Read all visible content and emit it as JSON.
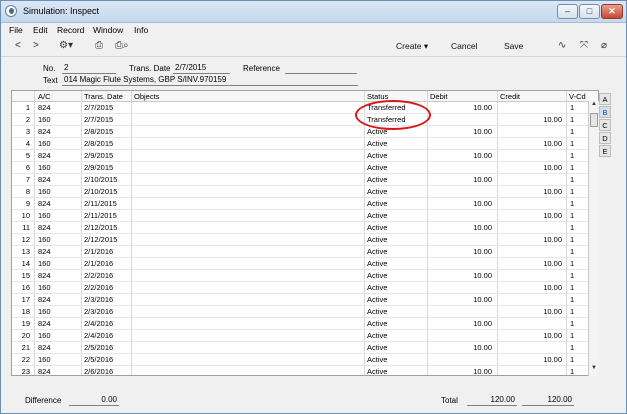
{
  "window": {
    "title": "Simulation: Inspect"
  },
  "menubar": {
    "items": [
      "File",
      "Edit",
      "Record",
      "Window",
      "Info"
    ]
  },
  "toolbar": {
    "create_label": "Create",
    "cancel_label": "Cancel",
    "save_label": "Save"
  },
  "header": {
    "no_label": "No.",
    "no_value": "2",
    "trans_date_label": "Trans. Date",
    "trans_date_value": "2/7/2015",
    "reference_label": "Reference",
    "reference_value": "",
    "text_label": "Text",
    "text_value": "014 Magic Flute Systems, GBP  S/INV.970159"
  },
  "grid": {
    "columns": [
      "A/C",
      "Trans. Date",
      "Objects",
      "Status",
      "Debit",
      "Credit",
      "V-Cd"
    ],
    "rows": [
      {
        "n": "1",
        "ac": "824",
        "date": "2/7/2015",
        "status": "Transferred",
        "debit": "10.00",
        "credit": "",
        "vcd": "1"
      },
      {
        "n": "2",
        "ac": "160",
        "date": "2/7/2015",
        "status": "Transferred",
        "debit": "",
        "credit": "10.00",
        "vcd": "1"
      },
      {
        "n": "3",
        "ac": "824",
        "date": "2/8/2015",
        "status": "Active",
        "debit": "10.00",
        "credit": "",
        "vcd": "1"
      },
      {
        "n": "4",
        "ac": "160",
        "date": "2/8/2015",
        "status": "Active",
        "debit": "",
        "credit": "10.00",
        "vcd": "1"
      },
      {
        "n": "5",
        "ac": "824",
        "date": "2/9/2015",
        "status": "Active",
        "debit": "10.00",
        "credit": "",
        "vcd": "1"
      },
      {
        "n": "6",
        "ac": "160",
        "date": "2/9/2015",
        "status": "Active",
        "debit": "",
        "credit": "10.00",
        "vcd": "1"
      },
      {
        "n": "7",
        "ac": "824",
        "date": "2/10/2015",
        "status": "Active",
        "debit": "10.00",
        "credit": "",
        "vcd": "1"
      },
      {
        "n": "8",
        "ac": "160",
        "date": "2/10/2015",
        "status": "Active",
        "debit": "",
        "credit": "10.00",
        "vcd": "1"
      },
      {
        "n": "9",
        "ac": "824",
        "date": "2/11/2015",
        "status": "Active",
        "debit": "10.00",
        "credit": "",
        "vcd": "1"
      },
      {
        "n": "10",
        "ac": "160",
        "date": "2/11/2015",
        "status": "Active",
        "debit": "",
        "credit": "10.00",
        "vcd": "1"
      },
      {
        "n": "11",
        "ac": "824",
        "date": "2/12/2015",
        "status": "Active",
        "debit": "10.00",
        "credit": "",
        "vcd": "1"
      },
      {
        "n": "12",
        "ac": "160",
        "date": "2/12/2015",
        "status": "Active",
        "debit": "",
        "credit": "10.00",
        "vcd": "1"
      },
      {
        "n": "13",
        "ac": "824",
        "date": "2/1/2016",
        "status": "Active",
        "debit": "10.00",
        "credit": "",
        "vcd": "1"
      },
      {
        "n": "14",
        "ac": "160",
        "date": "2/1/2016",
        "status": "Active",
        "debit": "",
        "credit": "10.00",
        "vcd": "1"
      },
      {
        "n": "15",
        "ac": "824",
        "date": "2/2/2016",
        "status": "Active",
        "debit": "10.00",
        "credit": "",
        "vcd": "1"
      },
      {
        "n": "16",
        "ac": "160",
        "date": "2/2/2016",
        "status": "Active",
        "debit": "",
        "credit": "10.00",
        "vcd": "1"
      },
      {
        "n": "17",
        "ac": "824",
        "date": "2/3/2016",
        "status": "Active",
        "debit": "10.00",
        "credit": "",
        "vcd": "1"
      },
      {
        "n": "18",
        "ac": "160",
        "date": "2/3/2016",
        "status": "Active",
        "debit": "",
        "credit": "10.00",
        "vcd": "1"
      },
      {
        "n": "19",
        "ac": "824",
        "date": "2/4/2016",
        "status": "Active",
        "debit": "10.00",
        "credit": "",
        "vcd": "1"
      },
      {
        "n": "20",
        "ac": "160",
        "date": "2/4/2016",
        "status": "Active",
        "debit": "",
        "credit": "10.00",
        "vcd": "1"
      },
      {
        "n": "21",
        "ac": "824",
        "date": "2/5/2016",
        "status": "Active",
        "debit": "10.00",
        "credit": "",
        "vcd": "1"
      },
      {
        "n": "22",
        "ac": "160",
        "date": "2/5/2016",
        "status": "Active",
        "debit": "",
        "credit": "10.00",
        "vcd": "1"
      },
      {
        "n": "23",
        "ac": "824",
        "date": "2/6/2016",
        "status": "Active",
        "debit": "10.00",
        "credit": "",
        "vcd": "1"
      }
    ]
  },
  "tabs": [
    "A",
    "B",
    "C",
    "D",
    "E"
  ],
  "active_tab": "B",
  "footer": {
    "difference_label": "Difference",
    "difference_value": "0.00",
    "total_label": "Total",
    "total_debit": "120.00",
    "total_credit": "120.00"
  },
  "colors": {
    "annotation": "#d81818",
    "active_tab": "#cfe0f3"
  }
}
